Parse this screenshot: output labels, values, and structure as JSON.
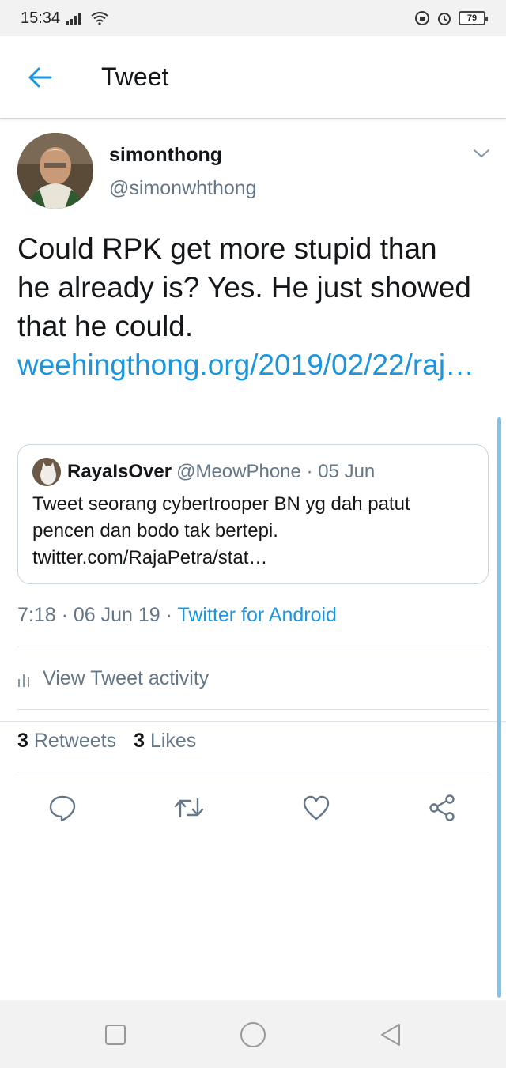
{
  "status_bar": {
    "time": "15:34",
    "battery": "79"
  },
  "header": {
    "title": "Tweet"
  },
  "tweet": {
    "name": "simonthong",
    "handle": "@simonwhthong",
    "text": "Could RPK get more stupid than he already is? Yes. He just showed that he could.",
    "link": "weehingthong.org/2019/02/22/raj…",
    "quoted": {
      "name": "RayaIsOver",
      "handle": "@MeowPhone · 05 Jun",
      "text": "Tweet seorang cybertrooper BN yg dah patut pencen dan bodo tak bertepi. twitter.com/RajaPetra/stat…"
    },
    "timestamp": "7:18 · 06 Jun 19 · ",
    "source": "Twitter for Android",
    "activity_label": "View Tweet activity",
    "retweets_count": "3",
    "retweets_label": "Retweets",
    "likes_count": "3",
    "likes_label": "Likes"
  },
  "icons": {
    "back": "arrow-left-icon",
    "caret": "chevron-down-icon",
    "reply": "reply-icon",
    "retweet": "retweet-icon",
    "like": "heart-icon",
    "share": "share-icon",
    "activity": "bar-chart-icon"
  },
  "colors": {
    "accent": "#1b95e0",
    "muted": "#657786",
    "text": "#14171a"
  }
}
